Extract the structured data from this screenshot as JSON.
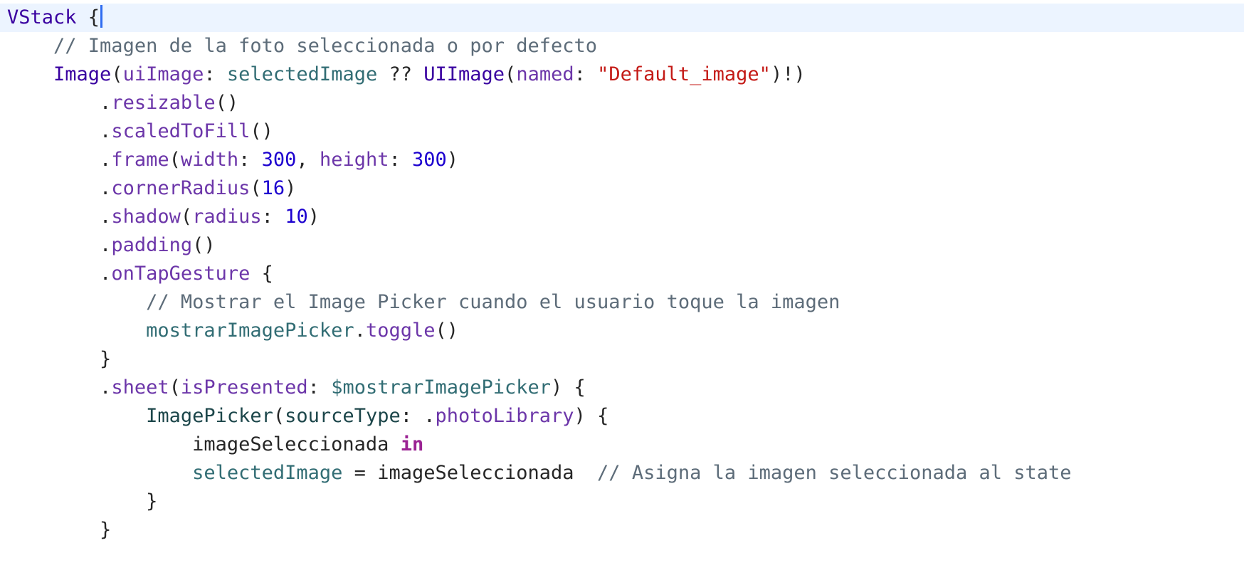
{
  "editor": {
    "language": "swift",
    "current_line": 1,
    "lines": [
      {
        "indent": "",
        "tokens": [
          [
            "type",
            "VStack"
          ],
          [
            "plain",
            " {"
          ]
        ],
        "caret": true
      },
      {
        "indent": "    ",
        "tokens": [
          [
            "cmt",
            "// Imagen de la foto seleccionada o por defecto"
          ]
        ]
      },
      {
        "indent": "    ",
        "tokens": [
          [
            "type",
            "Image"
          ],
          [
            "plain",
            "("
          ],
          [
            "param",
            "uiImage"
          ],
          [
            "plain",
            ": "
          ],
          [
            "prop",
            "selectedImage"
          ],
          [
            "plain",
            " ?? "
          ],
          [
            "type",
            "UIImage"
          ],
          [
            "plain",
            "("
          ],
          [
            "param",
            "named"
          ],
          [
            "plain",
            ": "
          ],
          [
            "str",
            "\"Default_image\""
          ],
          [
            "plain",
            ")!)"
          ]
        ]
      },
      {
        "indent": "        ",
        "tokens": [
          [
            "plain",
            "."
          ],
          [
            "fn",
            "resizable"
          ],
          [
            "plain",
            "()"
          ]
        ]
      },
      {
        "indent": "        ",
        "tokens": [
          [
            "plain",
            "."
          ],
          [
            "fn",
            "scaledToFill"
          ],
          [
            "plain",
            "()"
          ]
        ]
      },
      {
        "indent": "        ",
        "tokens": [
          [
            "plain",
            "."
          ],
          [
            "fn",
            "frame"
          ],
          [
            "plain",
            "("
          ],
          [
            "param",
            "width"
          ],
          [
            "plain",
            ": "
          ],
          [
            "num",
            "300"
          ],
          [
            "plain",
            ", "
          ],
          [
            "param",
            "height"
          ],
          [
            "plain",
            ": "
          ],
          [
            "num",
            "300"
          ],
          [
            "plain",
            ")"
          ]
        ]
      },
      {
        "indent": "        ",
        "tokens": [
          [
            "plain",
            "."
          ],
          [
            "fn",
            "cornerRadius"
          ],
          [
            "plain",
            "("
          ],
          [
            "num",
            "16"
          ],
          [
            "plain",
            ")"
          ]
        ]
      },
      {
        "indent": "        ",
        "tokens": [
          [
            "plain",
            "."
          ],
          [
            "fn",
            "shadow"
          ],
          [
            "plain",
            "("
          ],
          [
            "param",
            "radius"
          ],
          [
            "plain",
            ": "
          ],
          [
            "num",
            "10"
          ],
          [
            "plain",
            ")"
          ]
        ]
      },
      {
        "indent": "        ",
        "tokens": [
          [
            "plain",
            "."
          ],
          [
            "fn",
            "padding"
          ],
          [
            "plain",
            "()"
          ]
        ]
      },
      {
        "indent": "        ",
        "tokens": [
          [
            "plain",
            "."
          ],
          [
            "fn",
            "onTapGesture"
          ],
          [
            "plain",
            " {"
          ]
        ]
      },
      {
        "indent": "            ",
        "tokens": [
          [
            "cmt",
            "// Mostrar el Image Picker cuando el usuario toque la imagen"
          ]
        ]
      },
      {
        "indent": "            ",
        "tokens": [
          [
            "prop",
            "mostrarImagePicker"
          ],
          [
            "plain",
            "."
          ],
          [
            "fn",
            "toggle"
          ],
          [
            "plain",
            "()"
          ]
        ]
      },
      {
        "indent": "        ",
        "tokens": [
          [
            "plain",
            "}"
          ]
        ]
      },
      {
        "indent": "        ",
        "tokens": [
          [
            "plain",
            "."
          ],
          [
            "fn",
            "sheet"
          ],
          [
            "plain",
            "("
          ],
          [
            "param",
            "isPresented"
          ],
          [
            "plain",
            ": "
          ],
          [
            "prop",
            "$mostrarImagePicker"
          ],
          [
            "plain",
            ") {"
          ]
        ]
      },
      {
        "indent": "            ",
        "tokens": [
          [
            "typeproj",
            "ImagePicker"
          ],
          [
            "plain",
            "("
          ],
          [
            "typeproj",
            "sourceType"
          ],
          [
            "plain",
            ": ."
          ],
          [
            "fn",
            "photoLibrary"
          ],
          [
            "plain",
            ") {"
          ]
        ]
      },
      {
        "indent": "                ",
        "tokens": [
          [
            "plain",
            "imageSeleccionada "
          ],
          [
            "kw",
            "in"
          ]
        ]
      },
      {
        "indent": "                ",
        "tokens": [
          [
            "prop",
            "selectedImage"
          ],
          [
            "plain",
            " = imageSeleccionada  "
          ],
          [
            "cmt",
            "// Asigna la imagen seleccionada al state"
          ]
        ]
      },
      {
        "indent": "            ",
        "tokens": [
          [
            "plain",
            "}"
          ]
        ]
      },
      {
        "indent": "        ",
        "tokens": [
          [
            "plain",
            "}"
          ]
        ]
      }
    ]
  },
  "colors": {
    "background": "#ffffff",
    "current_line": "#ecf4ff",
    "caret": "#2f6cf0",
    "keyword": "#9b2393",
    "type": "#3900a0",
    "function": "#6c36a9",
    "property": "#326d74",
    "string": "#c41a16",
    "number": "#1c00cf",
    "comment": "#5d6c79"
  }
}
